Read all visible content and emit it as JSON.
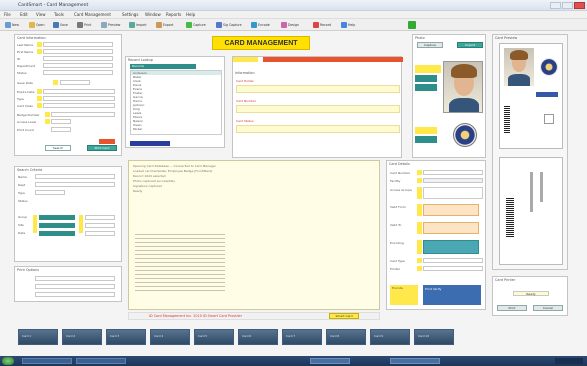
{
  "window": {
    "title": "CardSmart - Card Management",
    "menu": [
      "File",
      "Edit",
      "View",
      "Tools",
      "Card Management",
      "Settings",
      "Window",
      "Reports",
      "Help"
    ]
  },
  "toolbar": {
    "items": [
      "New",
      "Open",
      "Save",
      "Print",
      "Preview",
      "Import",
      "Export",
      "Capture",
      "Sig Capture",
      "Encode",
      "Design",
      "Record",
      "Help"
    ]
  },
  "header": {
    "title": "CARD MANAGEMENT"
  },
  "left_panel": {
    "title": "Card Information",
    "fields": [
      "Last Name",
      "First Name",
      "ID",
      "Department",
      "Status",
      "Issue Date",
      "Expire Date",
      "Type",
      "Card Class",
      "Badge Number",
      "Access Level",
      "Print Count"
    ],
    "buttons": [
      "Search",
      "Print Card"
    ]
  },
  "lookup_panel": {
    "title": "Record Lookup",
    "list_header": "Records",
    "rows": [
      "Anderson",
      "Baker",
      "Clark",
      "Davis",
      "Evans",
      "Foster",
      "Garcia",
      "Harris",
      "Jackson",
      "King",
      "Lewis",
      "Moore",
      "Nelson",
      "Owen",
      "Parker"
    ]
  },
  "info_panel": {
    "title": "Information",
    "labels": [
      "Card Holder",
      "Card Number",
      "Card Status"
    ]
  },
  "photo_panel": {
    "title": "Photo",
    "buttons": [
      "Capture",
      "Import",
      "Crop",
      "Signature"
    ]
  },
  "card_preview": {
    "title": "Card Preview",
    "front_title": "Front",
    "back_title": "Back"
  },
  "middle_left": {
    "title": "Search Criteria",
    "labels": [
      "Name",
      "Dept",
      "Type",
      "Status",
      "Group",
      "Site",
      "Date"
    ],
    "section2": "Print Options"
  },
  "log": {
    "lines": [
      "Opening Card Database ... Connected to Card Manager",
      "Loaded card template: Employee Badge (Front/Back)",
      "Record 1024 selected",
      "Photo captured successfully",
      "Signature captured",
      "Ready"
    ]
  },
  "status": {
    "message": "ID Card Management Inc. 2010 ID Smart Card Provider",
    "button": "Smart Card"
  },
  "right_form": {
    "title": "Card Details",
    "labels": [
      "Card Number",
      "Facility",
      "Access Groups",
      "Valid From",
      "Valid To",
      "Encoding",
      "Card Type",
      "Printer"
    ],
    "footer_labels": [
      "Encode",
      "Print",
      "Verify"
    ]
  },
  "card_printer": {
    "title": "Card Printer",
    "status": "Ready",
    "buttons": [
      "Print",
      "Cancel"
    ]
  },
  "thumbnails": [
    "Card 1",
    "Card 2",
    "Card 3",
    "Card 4",
    "Card 5",
    "Card 6",
    "Card 7",
    "Card 8",
    "Card 9",
    "Card 10"
  ],
  "colors": {
    "accent_yellow": "#ffe94a",
    "accent_teal": "#3aa79c",
    "header_red": "#e8522e",
    "log_bg": "#fffde6"
  }
}
